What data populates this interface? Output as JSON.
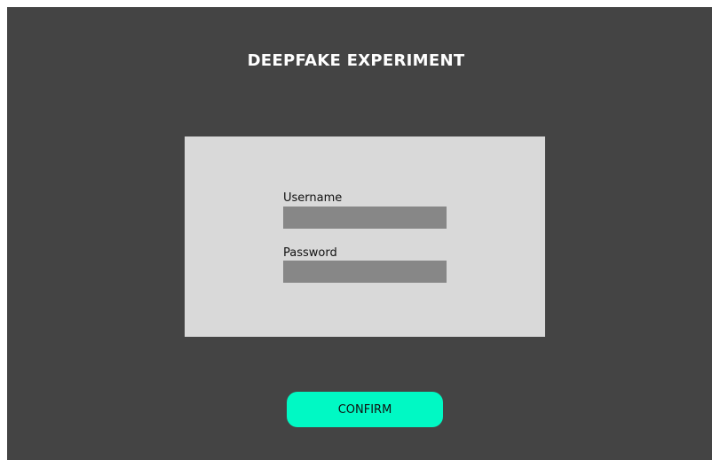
{
  "header": {
    "title": "DEEPFAKE EXPERIMENT"
  },
  "login_form": {
    "username_label": "Username",
    "username_value": "",
    "password_label": "Password",
    "password_value": ""
  },
  "actions": {
    "confirm_label": "CONFIRM"
  },
  "colors": {
    "background": "#444444",
    "panel": "#d9d9d9",
    "input": "#878787",
    "accent": "#00f9c4",
    "title_text": "#ffffff"
  }
}
